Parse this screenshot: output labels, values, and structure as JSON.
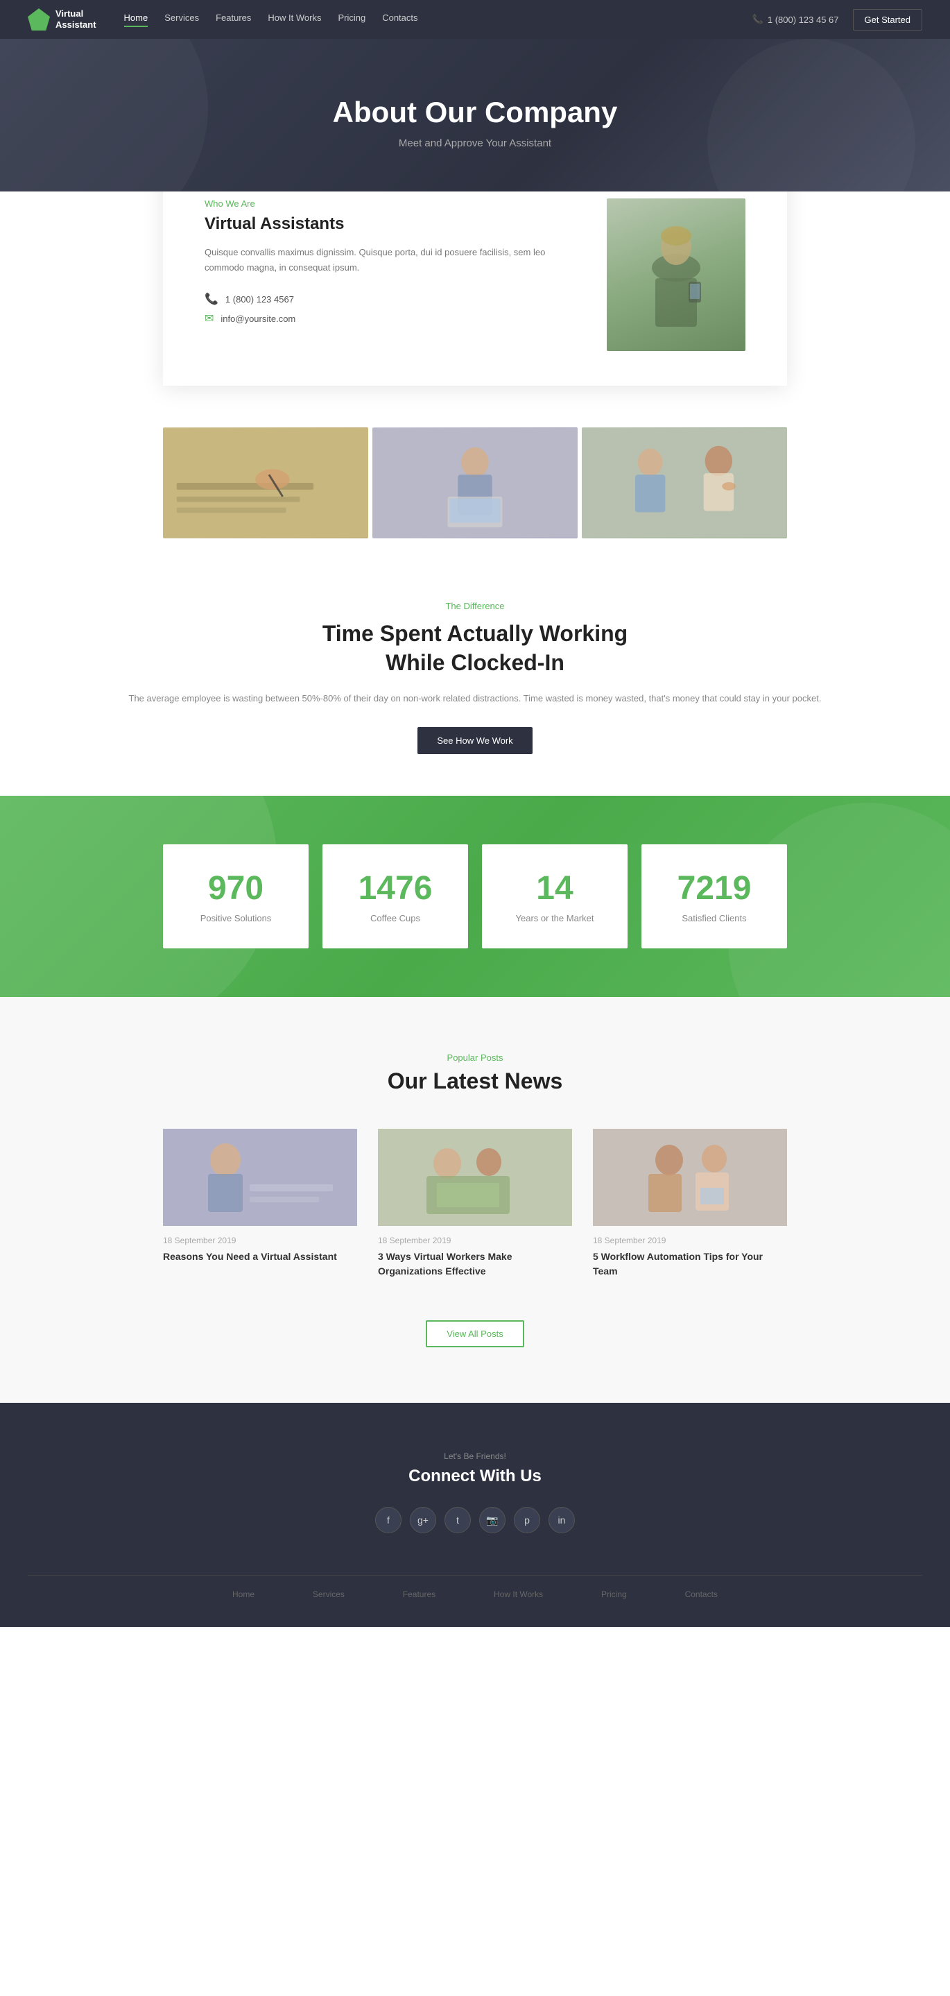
{
  "nav": {
    "logo_line1": "Virtual",
    "logo_line2": "Assistant",
    "links": [
      {
        "label": "Home",
        "active": true
      },
      {
        "label": "Services",
        "active": false
      },
      {
        "label": "Features",
        "active": false
      },
      {
        "label": "How It Works",
        "active": false
      },
      {
        "label": "Pricing",
        "active": false
      },
      {
        "label": "Contacts",
        "active": false
      }
    ],
    "phone": "1 (800) 123 45 67",
    "cta_label": "Get Started"
  },
  "hero": {
    "title": "About Our Company",
    "subtitle": "Meet and Approve Your Assistant"
  },
  "about": {
    "tag": "Who We Are",
    "title": "Virtual Assistants",
    "description": "Quisque convallis maximus dignissim. Quisque porta, dui id posuere facilisis, sem leo commodo magna, in consequat ipsum.",
    "phone": "1 (800) 123 4567",
    "email": "info@yoursite.com"
  },
  "difference": {
    "tag": "The Difference",
    "title": "Time Spent Actually Working\nWhile Clocked-In",
    "description": "The average employee is wasting between 50%-80% of their day on non-work related distractions. Time wasted is money wasted, that's money that could stay in your pocket.",
    "button_label": "See How We Work"
  },
  "stats": [
    {
      "number": "970",
      "label": "Positive Solutions"
    },
    {
      "number": "1476",
      "label": "Coffee Cups"
    },
    {
      "number": "14",
      "label": "Years or the Market"
    },
    {
      "number": "7219",
      "label": "Satisfied Clients"
    }
  ],
  "news": {
    "tag": "Popular Posts",
    "title": "Our Latest News",
    "posts": [
      {
        "date": "18 September 2019",
        "title": "Reasons You Need a Virtual Assistant"
      },
      {
        "date": "18 September 2019",
        "title": "3 Ways Virtual Workers Make Organizations Effective"
      },
      {
        "date": "18 September 2019",
        "title": "5 Workflow Automation Tips for Your Team"
      }
    ],
    "button_label": "View All Posts"
  },
  "footer": {
    "tag": "Let's Be Friends!",
    "title": "Connect With Us",
    "social": [
      {
        "icon": "f",
        "name": "facebook"
      },
      {
        "icon": "g+",
        "name": "google-plus"
      },
      {
        "icon": "t",
        "name": "twitter"
      },
      {
        "icon": "📷",
        "name": "instagram"
      },
      {
        "icon": "p",
        "name": "pinterest"
      },
      {
        "icon": "in",
        "name": "linkedin"
      }
    ]
  }
}
